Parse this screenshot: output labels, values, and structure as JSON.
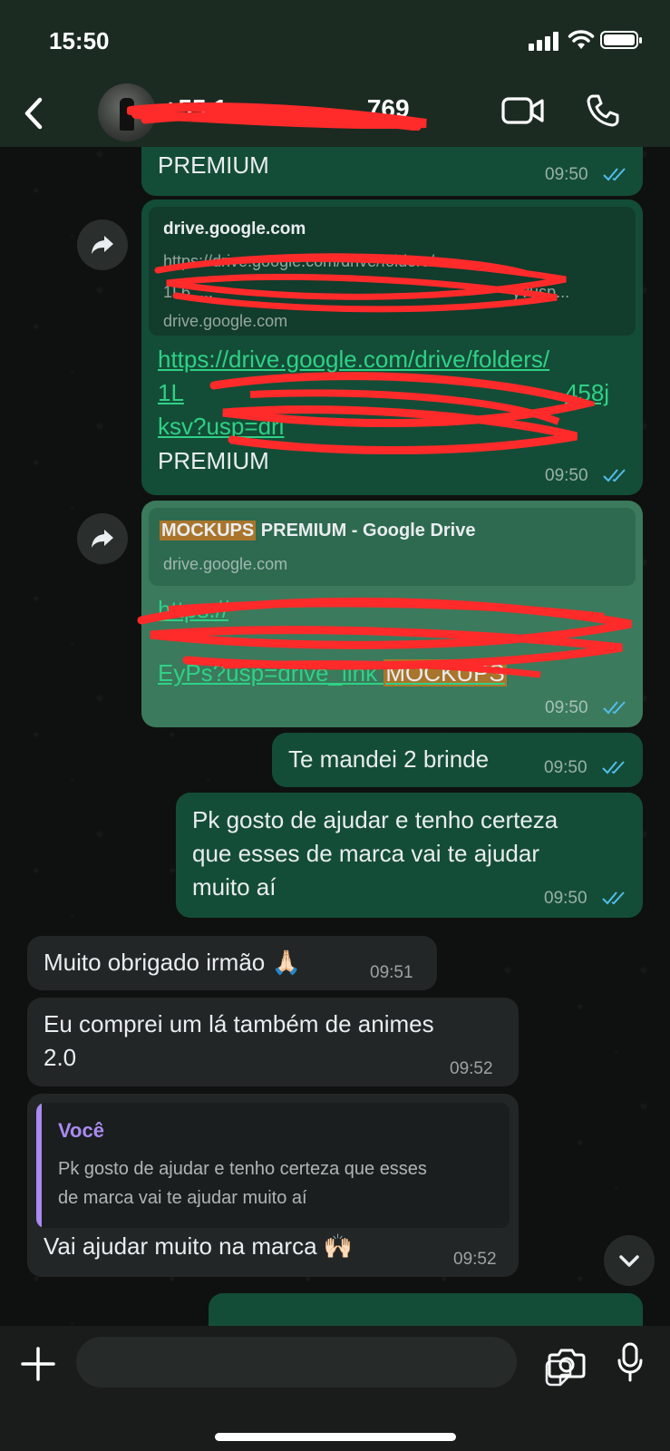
{
  "status_bar": {
    "time": "15:50"
  },
  "header": {
    "contact_prefix": "+55 1",
    "contact_suffix": "769",
    "icons": {
      "back": "chevron-left-icon",
      "video": "video-camera-icon",
      "call": "phone-icon"
    }
  },
  "messages": [
    {
      "id": "m1",
      "direction": "out",
      "text": "PREMIUM",
      "time": "09:50",
      "status": "read"
    },
    {
      "id": "m2",
      "direction": "out",
      "preview": {
        "title": "drive.google.com",
        "url_line1": "https://drive.google.com/drive/folders/",
        "url_line2": "1L6_...",
        "url_tail": "y?usp...",
        "domain": "drive.google.com"
      },
      "link_line1": "https://drive.google.com/drive/folders/",
      "link_line2_end": "458j",
      "link_line3_start": "ksv?usp=dri",
      "text": "PREMIUM",
      "time": "09:50",
      "status": "read"
    },
    {
      "id": "m3",
      "direction": "out",
      "preview": {
        "title_highlight": "MOCKUPS",
        "title_rest": " PREMIUM - Google Drive",
        "domain": "drive.google.com"
      },
      "link_line1_start": "https://",
      "link_line3": "EyPs?usp=drive_link",
      "highlight": "MOCKUPS",
      "time": "09:50",
      "status": "read"
    },
    {
      "id": "m4",
      "direction": "out",
      "text": "Te mandei 2 brinde",
      "time": "09:50",
      "status": "read"
    },
    {
      "id": "m5",
      "direction": "out",
      "lines": [
        "Pk gosto de ajudar e tenho certeza",
        "que esses de marca vai te ajudar",
        "muito aí"
      ],
      "time": "09:50",
      "status": "read"
    },
    {
      "id": "m6",
      "direction": "in",
      "text": "Muito obrigado irmão 🙏🏻",
      "time": "09:51"
    },
    {
      "id": "m7",
      "direction": "in",
      "lines": [
        "Eu comprei um lá também de animes",
        "2.0"
      ],
      "time": "09:52"
    },
    {
      "id": "m8",
      "direction": "in",
      "quote": {
        "author": "Você",
        "lines": [
          "Pk gosto de ajudar e tenho certeza que esses",
          "de marca vai te ajudar muito aí"
        ]
      },
      "text": "Vai ajudar muito na marca 🙌🏻",
      "time": "09:52"
    }
  ],
  "composer": {
    "icons": {
      "attach": "plus-icon",
      "sticker": "sticker-icon",
      "camera": "camera-icon",
      "mic": "microphone-icon"
    },
    "placeholder": ""
  },
  "colors": {
    "outgoing": "#144d37",
    "incoming": "#232626",
    "read_ticks": "#53bdeb",
    "quote_accent": "#a98bf2",
    "highlight": "#a9752c",
    "redaction": "#ff2a2a"
  }
}
